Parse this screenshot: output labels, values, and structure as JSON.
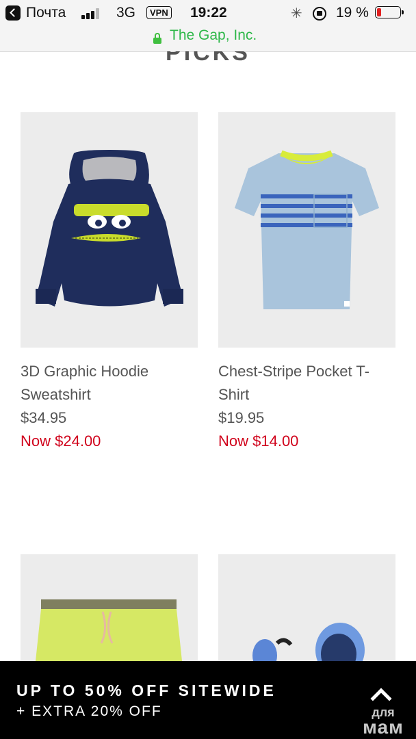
{
  "status_bar": {
    "carrier": "Почта",
    "network": "3G",
    "vpn": "VPN",
    "time": "19:22",
    "battery_percent": "19 %",
    "battery_level": 0.19,
    "battery_color": "#e02020"
  },
  "url_bar": {
    "site": "The Gap, Inc.",
    "secure_icon": "lock-icon",
    "accent_color": "#2fb84a"
  },
  "section": {
    "title": "PICKS"
  },
  "products": [
    {
      "name": "3D Graphic Hoodie Sweatshirt",
      "price": "$34.95",
      "sale_price": "Now $24.00",
      "image": "navy-hoodie-image"
    },
    {
      "name": "Chest-Stripe Pocket T-Shirt",
      "price": "$19.95",
      "sale_price": "Now $14.00",
      "image": "stripe-tshirt-image"
    },
    {
      "image": "yellow-shorts-image"
    },
    {
      "image": "blue-flip-flops-image"
    }
  ],
  "promo": {
    "headline": "UP TO 50% OFF SITEWIDE",
    "subline": "+ EXTRA 20% OFF",
    "sale_color": "#d0021b"
  },
  "watermark": {
    "line1": "для",
    "line2": "мам"
  }
}
